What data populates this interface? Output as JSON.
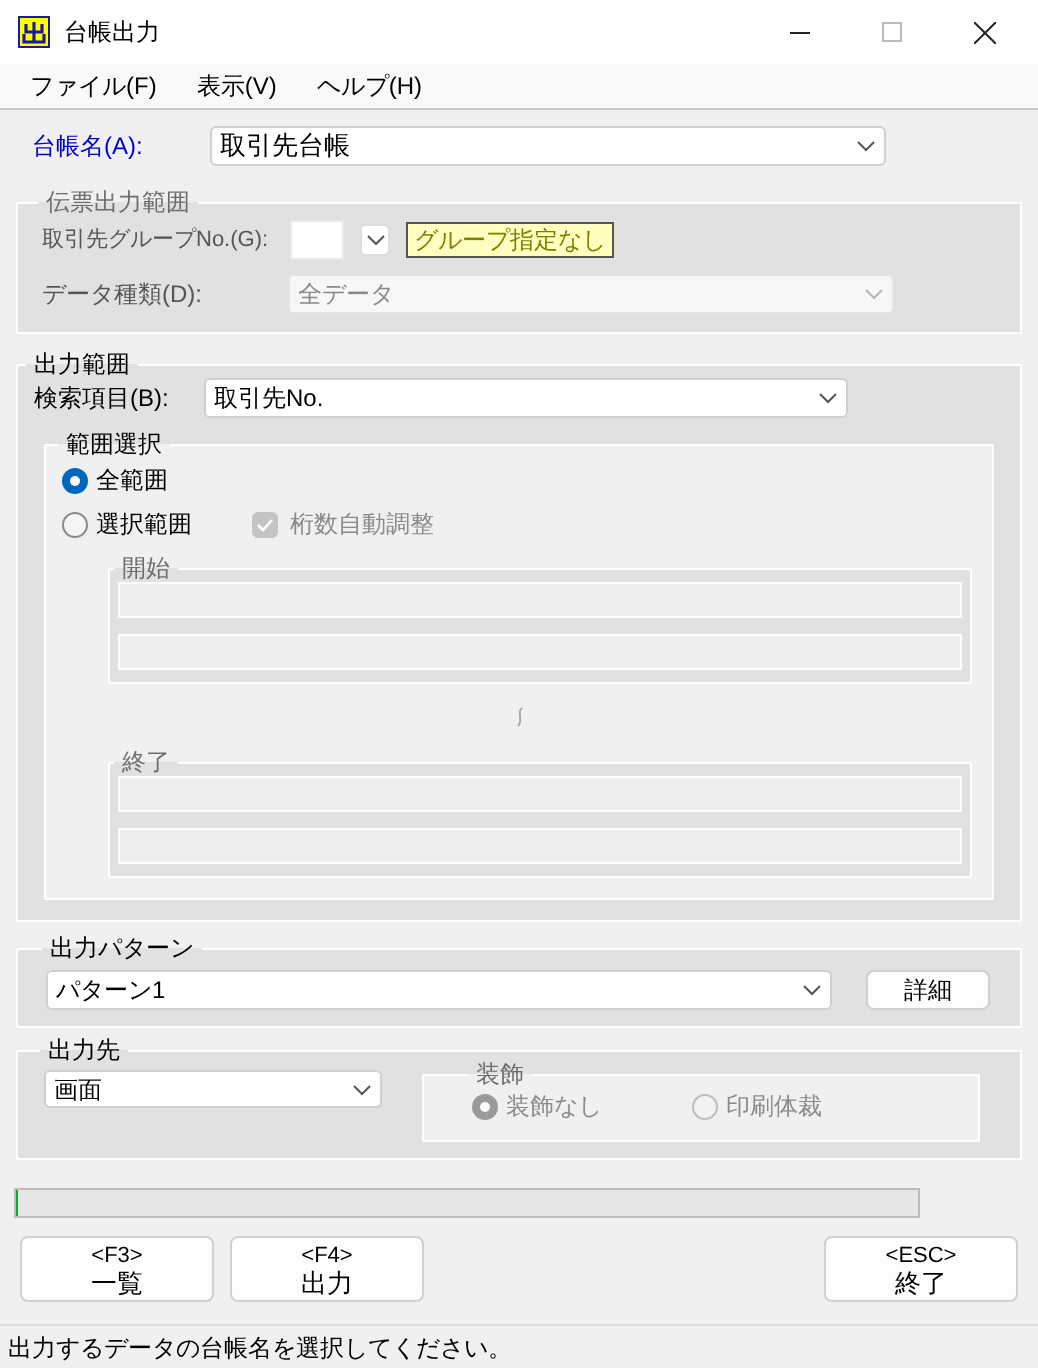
{
  "window": {
    "title": "台帳出力"
  },
  "menu": [
    {
      "label": "ファイル(F)"
    },
    {
      "label": "表示(V)"
    },
    {
      "label": "ヘルプ(H)"
    }
  ],
  "ledger": {
    "label": "台帳名(A):",
    "value": "取引先台帳"
  },
  "slip_range": {
    "title": "伝票出力範囲",
    "disabled": true,
    "group_no": {
      "label": "取引先グループNo.(G):",
      "badge": "グループ指定なし"
    },
    "data_type": {
      "label": "データ種類(D):",
      "value": "全データ"
    }
  },
  "output_range": {
    "title": "出力範囲",
    "search_item": {
      "label": "検索項目(B):",
      "value": "取引先No."
    },
    "range_select": {
      "title": "範囲選択",
      "options": [
        {
          "label": "全範囲",
          "selected": true
        },
        {
          "label": "選択範囲",
          "selected": false
        }
      ],
      "auto_digits": {
        "label": "桁数自動調整",
        "checked": true,
        "disabled": true
      },
      "start": {
        "title": "開始",
        "disabled": true
      },
      "end": {
        "title": "終了",
        "disabled": true
      }
    }
  },
  "output_pattern": {
    "title": "出力パターン",
    "value": "パターン1",
    "button": "詳細"
  },
  "output_dest": {
    "title": "出力先",
    "value": "画面",
    "decoration": {
      "title": "装飾",
      "disabled": true,
      "options": [
        {
          "label": "装飾なし",
          "selected": true
        },
        {
          "label": "印刷体裁",
          "selected": false
        }
      ]
    }
  },
  "progress": {
    "level": 0
  },
  "buttons": [
    {
      "key": "<F3>",
      "label": "一覧"
    },
    {
      "key": "<F4>",
      "label": "出力"
    },
    {
      "key": "<ESC>",
      "label": "終了"
    }
  ],
  "status_bar": "出力するデータの台帳名を選択してください。"
}
